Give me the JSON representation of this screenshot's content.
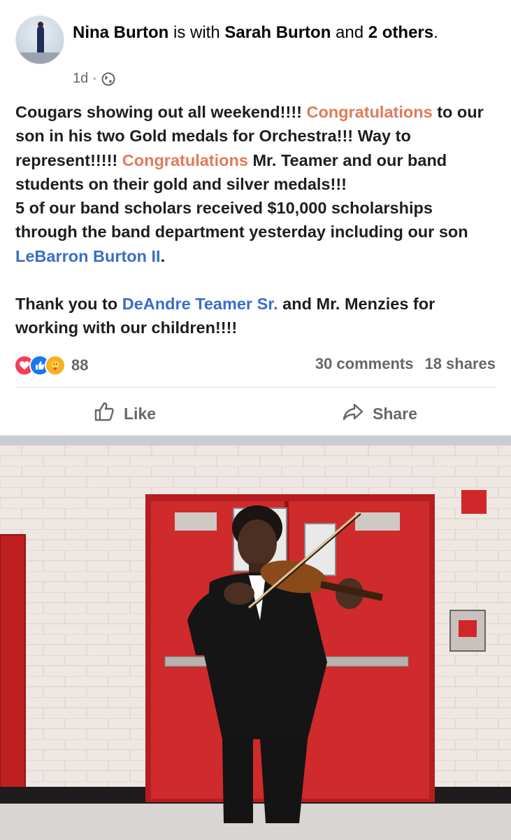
{
  "post": {
    "author": "Nina Burton",
    "with_text": " is with ",
    "tagged": "Sarah Burton",
    "and_text": " and ",
    "others": "2 others",
    "period": ".",
    "time": "1d",
    "dot": "·",
    "privacy_icon": "globe-icon",
    "body": {
      "s1": "Cougars showing out all weekend!!!! ",
      "s2": "Congratulations",
      "s3": " to our son in his two Gold medals for Orchestra!!! Way to represent!!!!! ",
      "s4": "Congratulations",
      "s5": " Mr. Teamer and our band students on their gold and silver medals!!!",
      "s6": "5 of our band scholars received $10,000 scholarships through the band department yesterday including our son ",
      "s7": "LeBarron Burton II",
      "s8": ".",
      "s9": "Thank you to ",
      "s10": "DeAndre Teamer Sr.",
      "s11": " and Mr. Menzies for working with our children!!!!"
    },
    "reaction_count": "88",
    "reaction_icons": [
      "love-icon",
      "like-icon",
      "care-icon"
    ],
    "comments": "30 comments",
    "shares": "18 shares",
    "actions": {
      "like": "Like",
      "share": "Share"
    },
    "colors": {
      "orange": "#e07b5a",
      "blue": "#3b6dc6",
      "gray": "#65676b"
    }
  },
  "photo": {
    "subject": "young man in black suit playing violin in front of red double doors"
  }
}
